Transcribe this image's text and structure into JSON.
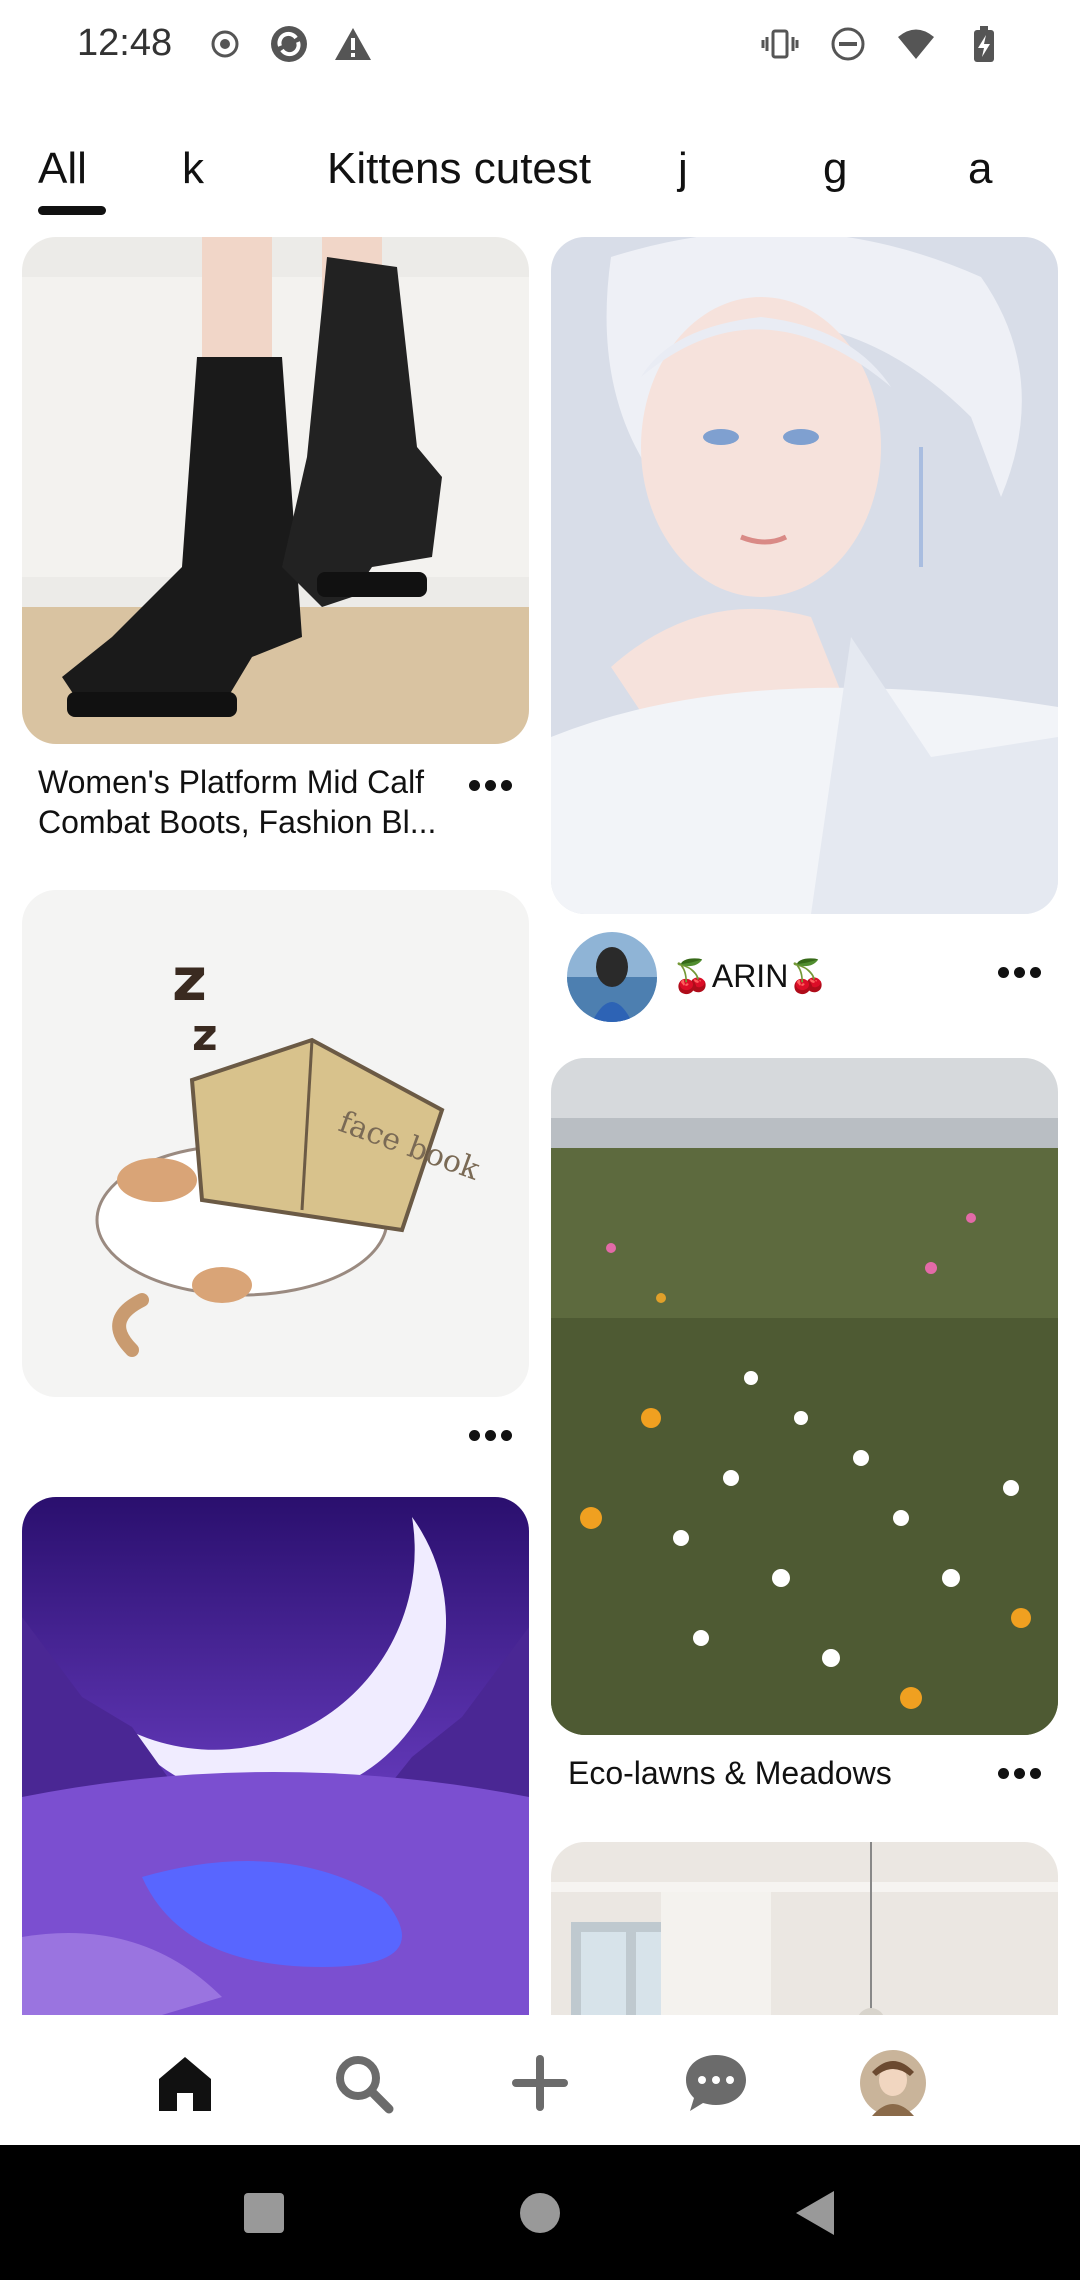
{
  "status_bar": {
    "time": "12:48"
  },
  "tabs": [
    {
      "label": "All",
      "selected": true
    },
    {
      "label": "k"
    },
    {
      "label": "Kittens cutest"
    },
    {
      "label": "j"
    },
    {
      "label": "g"
    },
    {
      "label": "a"
    }
  ],
  "feed": {
    "pins": [
      {
        "title": "Women's Platform Mid Calf Combat Boots, Fashion Bl...",
        "image": "black-boots-image"
      },
      {
        "image": "anime-portrait-image",
        "creator": "🍒ARIN🍒"
      },
      {
        "image": "sleeping-cat-book-image",
        "image_text": "face book"
      },
      {
        "title": "Eco-lawns & Meadows",
        "image": "wildflower-meadow-image"
      },
      {
        "image": "purple-moon-landscape-image"
      },
      {
        "image": "room-window-image"
      }
    ]
  },
  "bottom_nav": {
    "items": [
      "home-icon",
      "search-icon",
      "create-icon",
      "messages-icon",
      "profile-avatar"
    ]
  },
  "colors": {
    "text": "#111111",
    "background": "#ffffff",
    "system_nav": "#000000"
  }
}
